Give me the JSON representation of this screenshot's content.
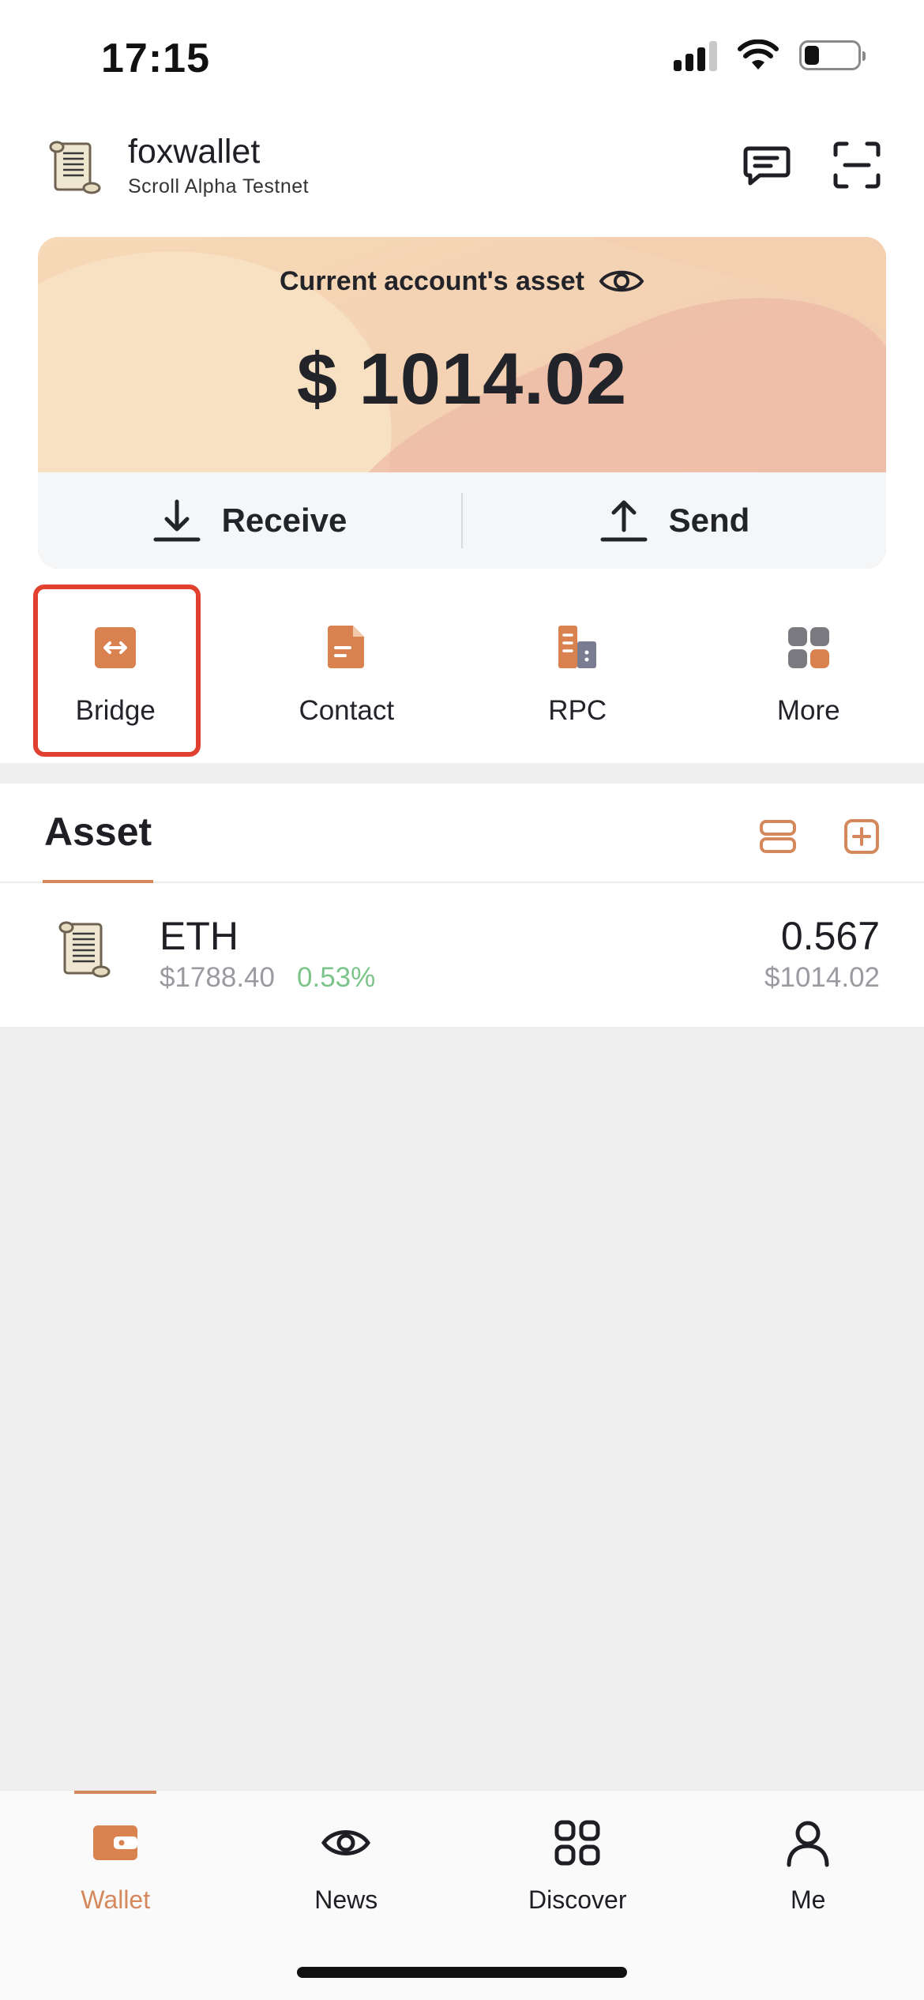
{
  "status_bar": {
    "time": "17:15"
  },
  "header": {
    "wallet_name": "foxwallet",
    "network": "Scroll Alpha Testnet"
  },
  "asset_card": {
    "title": "Current account's asset",
    "balance": "$ 1014.02",
    "receive_label": "Receive",
    "send_label": "Send"
  },
  "quick_menu": [
    {
      "label": "Bridge",
      "icon": "bridge-icon"
    },
    {
      "label": "Contact",
      "icon": "contact-icon"
    },
    {
      "label": "RPC",
      "icon": "rpc-icon"
    },
    {
      "label": "More",
      "icon": "more-icon"
    }
  ],
  "assets": {
    "title": "Asset",
    "tokens": [
      {
        "symbol": "ETH",
        "price": "$1788.40",
        "change": "0.53%",
        "amount": "0.567",
        "value": "$1014.02"
      }
    ]
  },
  "tabbar": {
    "items": [
      {
        "label": "Wallet",
        "icon": "wallet-icon",
        "active": true
      },
      {
        "label": "News",
        "icon": "eye-icon",
        "active": false
      },
      {
        "label": "Discover",
        "icon": "grid-icon",
        "active": false
      },
      {
        "label": "Me",
        "icon": "user-icon",
        "active": false
      }
    ]
  },
  "colors": {
    "accent": "#d4885b",
    "highlight": "#e2402f",
    "positive": "#7cc48a"
  }
}
